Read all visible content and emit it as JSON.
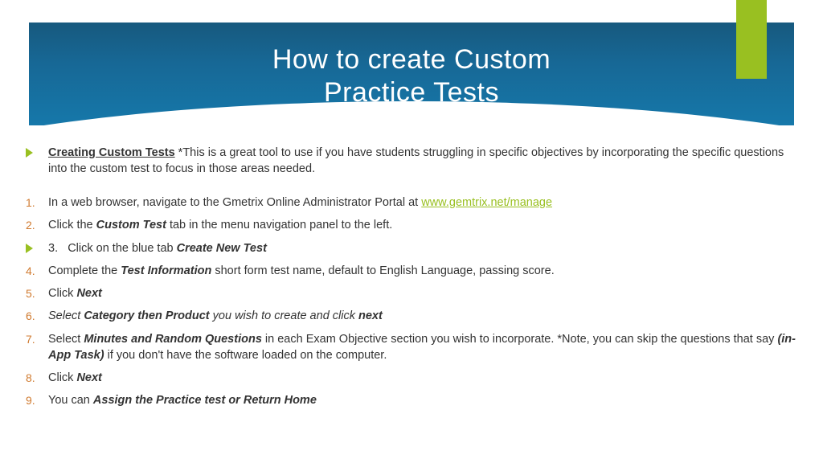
{
  "title_line1": "How to create Custom",
  "title_line2": "Practice Tests",
  "intro": {
    "lead": "Creating Custom Tests",
    "rest": " *This is a great tool to use if you have students struggling in specific objectives by incorporating the specific questions into the custom test to focus in those areas needed."
  },
  "steps": {
    "s1": {
      "num": "1.",
      "pre": "In a web browser, navigate to the Gmetrix Online Administrator Portal at ",
      "link_text": "www.gemtrix.net/manage",
      "link_href": "http://www.gemtrix.net/manage"
    },
    "s2": {
      "num": "2.",
      "pre": "Click the ",
      "bold": "Custom Test",
      "post": " tab in the menu navigation panel to the left."
    },
    "s3": {
      "label": "3.",
      "pre": "Click on the blue tab ",
      "bold": "Create New Test"
    },
    "s4": {
      "num": "4.",
      "pre": "Complete the ",
      "bold": "Test Information",
      "post": " short form test name, default to English Language, passing score."
    },
    "s5": {
      "num": "5.",
      "pre": "Click ",
      "bold": "Next"
    },
    "s6": {
      "num": "6.",
      "italic_pre": "Select ",
      "bold1": "Category then Product",
      "mid": " you wish to create and click ",
      "bold2": "next"
    },
    "s7": {
      "num": "7.",
      "pre": "Select ",
      "bold1": "Minutes and Random Questions",
      "mid": " in each Exam Objective section you wish to incorporate. *Note, you can skip the questions that say ",
      "bold2": "(in-App Task)",
      "post": " if you don't have the software loaded on the computer."
    },
    "s8": {
      "num": "8.",
      "pre": "Click ",
      "bold": "Next"
    },
    "s9": {
      "num": "9.",
      "pre": "You can ",
      "bold": "Assign the Practice test or Return Home"
    }
  }
}
